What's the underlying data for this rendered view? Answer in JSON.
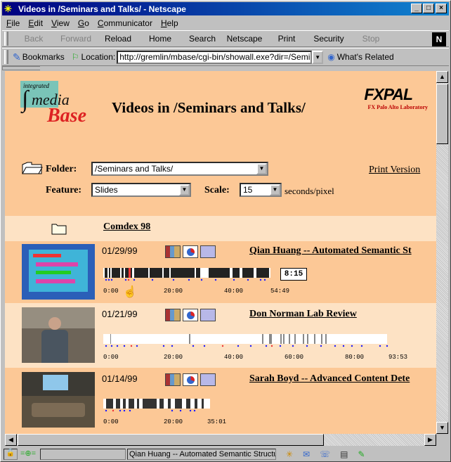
{
  "window": {
    "title": "Videos in /Seminars and Talks/ - Netscape"
  },
  "menu": [
    "File",
    "Edit",
    "View",
    "Go",
    "Communicator",
    "Help"
  ],
  "nav": [
    {
      "label": "Back",
      "enabled": false
    },
    {
      "label": "Forward",
      "enabled": false
    },
    {
      "label": "Reload",
      "enabled": true
    },
    {
      "label": "Home",
      "enabled": true
    },
    {
      "label": "Search",
      "enabled": true
    },
    {
      "label": "Netscape",
      "enabled": true
    },
    {
      "label": "Print",
      "enabled": true
    },
    {
      "label": "Security",
      "enabled": true
    },
    {
      "label": "Stop",
      "enabled": false
    }
  ],
  "location": {
    "bookmarks": "Bookmarks",
    "label": "Location:",
    "url": "http://gremlin/mbase/cgi-bin/showall.exe?dir=/Semi",
    "related": "What's Related"
  },
  "page": {
    "logo_small": "integrated",
    "logo_media": "media",
    "logo_base": "Base",
    "title": "Videos in /Seminars and Talks/",
    "fx_logo": "FXPAL",
    "fx_sub": "FX Palo Alto Laboratory",
    "folder_label": "Folder:",
    "folder_value": "/Seminars and Talks/",
    "print_version": "Print Version",
    "feature_label": "Feature:",
    "feature_value": "Slides",
    "scale_label": "Scale:",
    "scale_value": "15",
    "scale_unit": "seconds/pixel",
    "subfolder": "Comdex 98"
  },
  "videos": [
    {
      "date": "01/29/99",
      "title": "Qian Huang -- Automated Semantic St",
      "duration_box": "8:15",
      "ticks": [
        "0:00",
        "20:00",
        "40:00",
        "54:49"
      ]
    },
    {
      "date": "01/21/99",
      "title": "Don Norman Lab Review",
      "duration_box": "",
      "ticks": [
        "0:00",
        "20:00",
        "40:00",
        "60:00",
        "80:00",
        "93:53"
      ]
    },
    {
      "date": "01/14/99",
      "title": "Sarah Boyd -- Advanced Content Dete",
      "duration_box": "",
      "ticks": [
        "0:00",
        "20:00",
        "35:01"
      ]
    }
  ],
  "status": {
    "text": "Qian Huang -- Automated Semantic Structure"
  },
  "colors": {
    "page_bg": "#fcc896",
    "row_alt": "#fde2c4",
    "title_bar": "#000080"
  }
}
